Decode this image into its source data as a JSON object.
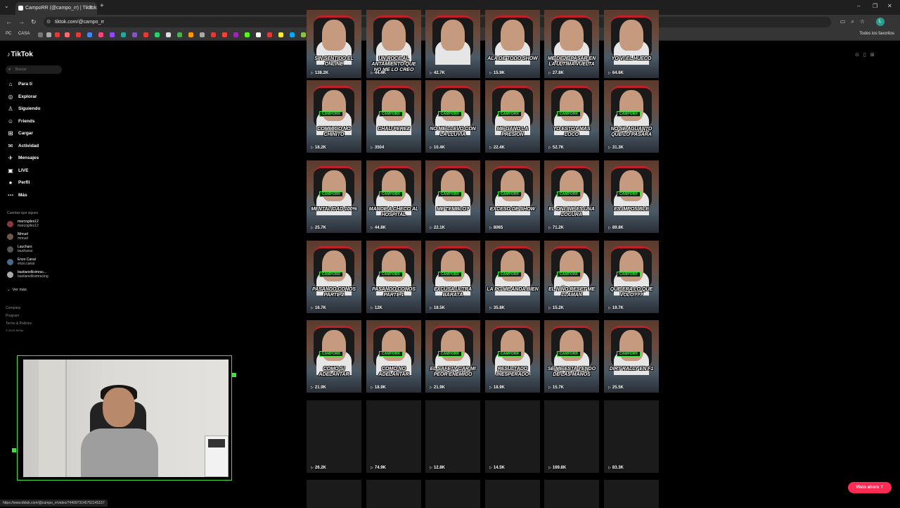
{
  "browser": {
    "tab_title": "CampoRR (@campo_rr) | TikTok",
    "url": "tiktok.com/@campo_rr",
    "bookmarks": [
      "PC",
      "CASA"
    ],
    "bookmarks_right": "Todos los favoritos",
    "profile_initial": "L",
    "status_url": "https://www.tiktok.com/@campo_rr/video/7449973145752145157"
  },
  "sidebar": {
    "logo": "TikTok",
    "search_placeholder": "Buscar",
    "nav": [
      {
        "label": "Para ti",
        "icon": "home-icon",
        "glyph": "⌂"
      },
      {
        "label": "Explorar",
        "icon": "compass-icon",
        "glyph": "◎"
      },
      {
        "label": "Siguiendo",
        "icon": "following-icon",
        "glyph": "♙"
      },
      {
        "label": "Friends",
        "icon": "friends-icon",
        "glyph": "☺"
      },
      {
        "label": "Cargar",
        "icon": "upload-icon",
        "glyph": "⊞"
      },
      {
        "label": "Actividad",
        "icon": "activity-icon",
        "glyph": "✉"
      },
      {
        "label": "Mensajes",
        "icon": "messages-icon",
        "glyph": "✈"
      },
      {
        "label": "LIVE",
        "icon": "live-icon",
        "glyph": "▣"
      },
      {
        "label": "Perfil",
        "icon": "profile-icon",
        "glyph": "●"
      },
      {
        "label": "Más",
        "icon": "more-icon",
        "glyph": "⋯"
      }
    ],
    "following_title": "Cuentas que sigues",
    "following": [
      {
        "name": "marcogiles12",
        "handle": "marcogiles12",
        "color": "#8a3a3a"
      },
      {
        "name": "Mmuel",
        "handle": "mmuel",
        "color": "#6b5b4b"
      },
      {
        "name": "Lauchars",
        "handle": "laucharss",
        "color": "#555555"
      },
      {
        "name": "Enzo Canal",
        "handle": "enzo.canal",
        "color": "#4a6a8a"
      },
      {
        "name": "bastianellisimrac...",
        "handle": "bastianellisimracing",
        "color": "#aaaaaa"
      }
    ],
    "ver_mas": "Ver más",
    "footer": [
      "Company",
      "Program",
      "Terms & Policies",
      "© 2025 TikTok"
    ]
  },
  "videos": [
    {
      "caption": "SIN SENTIDO EL ONLINE",
      "views": "138.2K"
    },
    {
      "caption": "UN ROCE AL ANTAMIENTO QUE NO ME LO CREO",
      "views": "44.4K"
    },
    {
      "caption": "",
      "views": "42.7K"
    },
    {
      "caption": "ALA DE TODO SHOW",
      "views": "15.9K"
    },
    {
      "caption": "ME DEJE PASAR EN LA ÚLTIMA VUELTA",
      "views": "27.8K"
    },
    {
      "caption": "YO VI EL HUECO",
      "views": "64.6K"
    },
    {
      "caption": "COMMIGO NO CHINITO",
      "views": "18.2K"
    },
    {
      "caption": "CHAU PEREZ",
      "views": "3504"
    },
    {
      "caption": "NO ME LLEVO CON LA LLUVIA",
      "views": "10.4K"
    },
    {
      "caption": "ME GANO LA PRESION",
      "views": "22.4K"
    },
    {
      "caption": "YO ESTOY MAS LOCO",
      "views": "52.7K"
    },
    {
      "caption": "NO SE AGUANTO QUE LO PASARA",
      "views": "31.3K"
    },
    {
      "caption": "MENTALIDAD 100%",
      "views": "25.7K"
    },
    {
      "caption": "MANDE A CHECO AL HOSPITAL",
      "views": "44.8K"
    },
    {
      "caption": "ME TEMBLO?",
      "views": "22.1K"
    },
    {
      "caption": "EXCESO DE SHOW",
      "views": "8065"
    },
    {
      "caption": "EL ONLINE ES UNA LOCURA",
      "views": "71.2K"
    },
    {
      "caption": "ES IMPOSIBLE",
      "views": "89.8K"
    },
    {
      "caption": "PASANDO CONOS PARTE 2",
      "views": "16.7K"
    },
    {
      "caption": "PASANDO CONOS PARTE 1",
      "views": "12K"
    },
    {
      "caption": "EXCUSA ULTRA BARATA",
      "views": "18.5K"
    },
    {
      "caption": "LA PC ME ANDA BIEN",
      "views": "35.8K"
    },
    {
      "caption": "EL NIÑO RESET ME LLAMAN",
      "views": "15.2K"
    },
    {
      "caption": "QUE ERA LO QUE VOLO???",
      "views": "19.7K"
    },
    {
      "caption": "COMO SI ADELANTAR",
      "views": "21.9K"
    },
    {
      "caption": "COMO NO ADELANTAR",
      "views": "18.9K"
    },
    {
      "caption": "EL SAFETY CAR MI PEOR ENEMIGO",
      "views": "21.9K"
    },
    {
      "caption": "RESULTADO INESPERADO",
      "views": "18.9K"
    },
    {
      "caption": "SE ME ESTA YENDO DE LAS MANOS",
      "views": "15.7K"
    },
    {
      "caption": "DIRT RALLY EN F1",
      "views": "25.5K"
    },
    {
      "caption": "",
      "views": "26.2K"
    },
    {
      "caption": "",
      "views": "74.9K"
    },
    {
      "caption": "",
      "views": "12.8K"
    },
    {
      "caption": "",
      "views": "14.5K"
    },
    {
      "caption": "",
      "views": "169.8K"
    },
    {
      "caption": "",
      "views": "83.3K"
    }
  ],
  "brand_tag": "CAMPORR",
  "visto_ahora": "Visto ahora ⇡",
  "colors": {
    "accent": "#fe2c55",
    "green": "#39e639"
  }
}
